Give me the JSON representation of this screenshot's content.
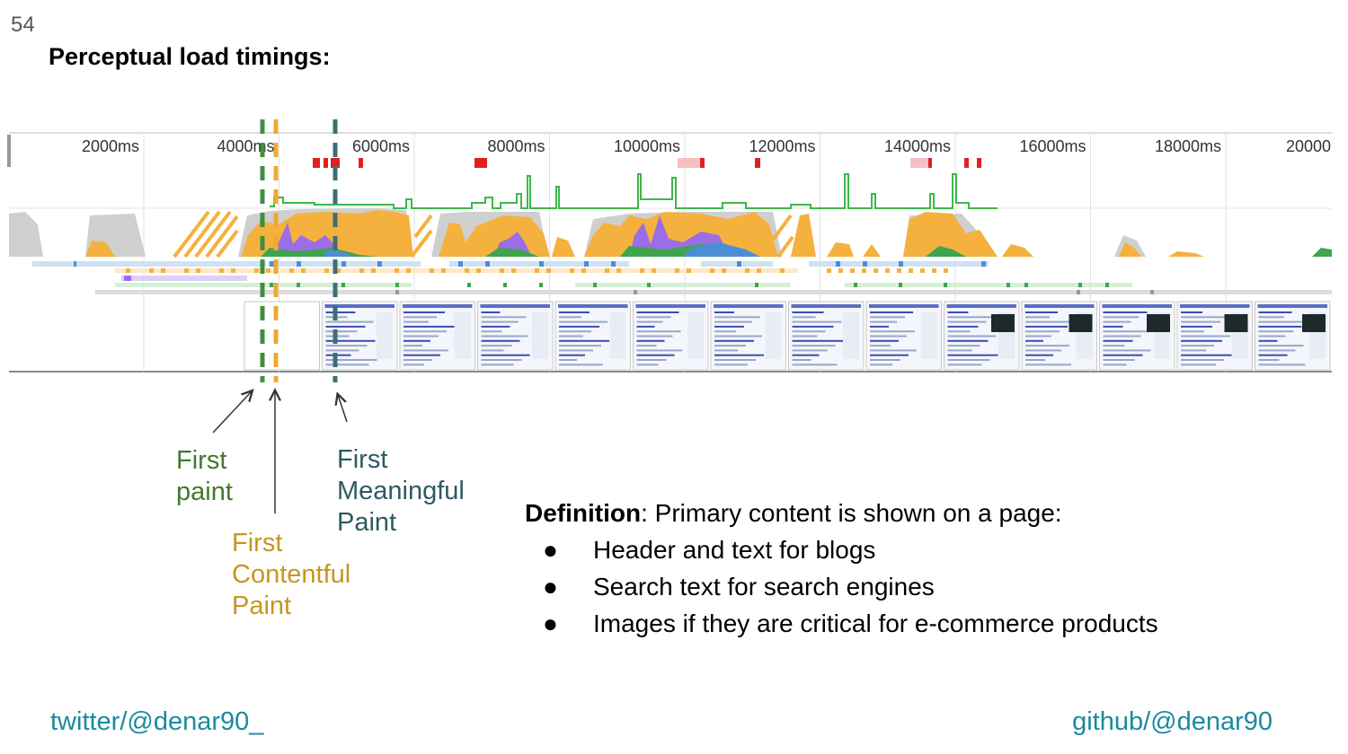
{
  "slide": {
    "number": "54",
    "title": "Perceptual load timings:"
  },
  "timeline": {
    "ticks": [
      "2000ms",
      "4000ms",
      "6000ms",
      "8000ms",
      "10000ms",
      "12000ms",
      "14000ms",
      "16000ms",
      "18000ms",
      "20000"
    ],
    "markers": [
      {
        "name": "first-paint-marker",
        "color": "#3f8f3f"
      },
      {
        "name": "first-contentful-paint-marker",
        "color": "#f0a830"
      },
      {
        "name": "first-meaningful-paint-marker",
        "color": "#3e6e76"
      }
    ],
    "colors": {
      "scripting": "#f5b13d",
      "rendering": "#9b6ee6",
      "painting": "#3ea44e",
      "idle": "#c8c8c8",
      "loading": "#4a8fd6",
      "fps": "#3cb84a",
      "red": "#e02020"
    }
  },
  "annotations": {
    "first_paint": [
      "First",
      "paint"
    ],
    "first_meaningful_paint": [
      "First",
      "Meaningful",
      "Paint"
    ],
    "first_contentful_paint": [
      "First",
      "Contentful",
      "Paint"
    ]
  },
  "definition": {
    "term": "Definition",
    "text": ": Primary content is shown on a page:",
    "bullets": [
      "Header and text for blogs",
      "Search text for search engines",
      "Images if they are critical for e-commerce products"
    ]
  },
  "footer": {
    "twitter": "twitter/@denar90_",
    "github": "github/@denar90"
  }
}
